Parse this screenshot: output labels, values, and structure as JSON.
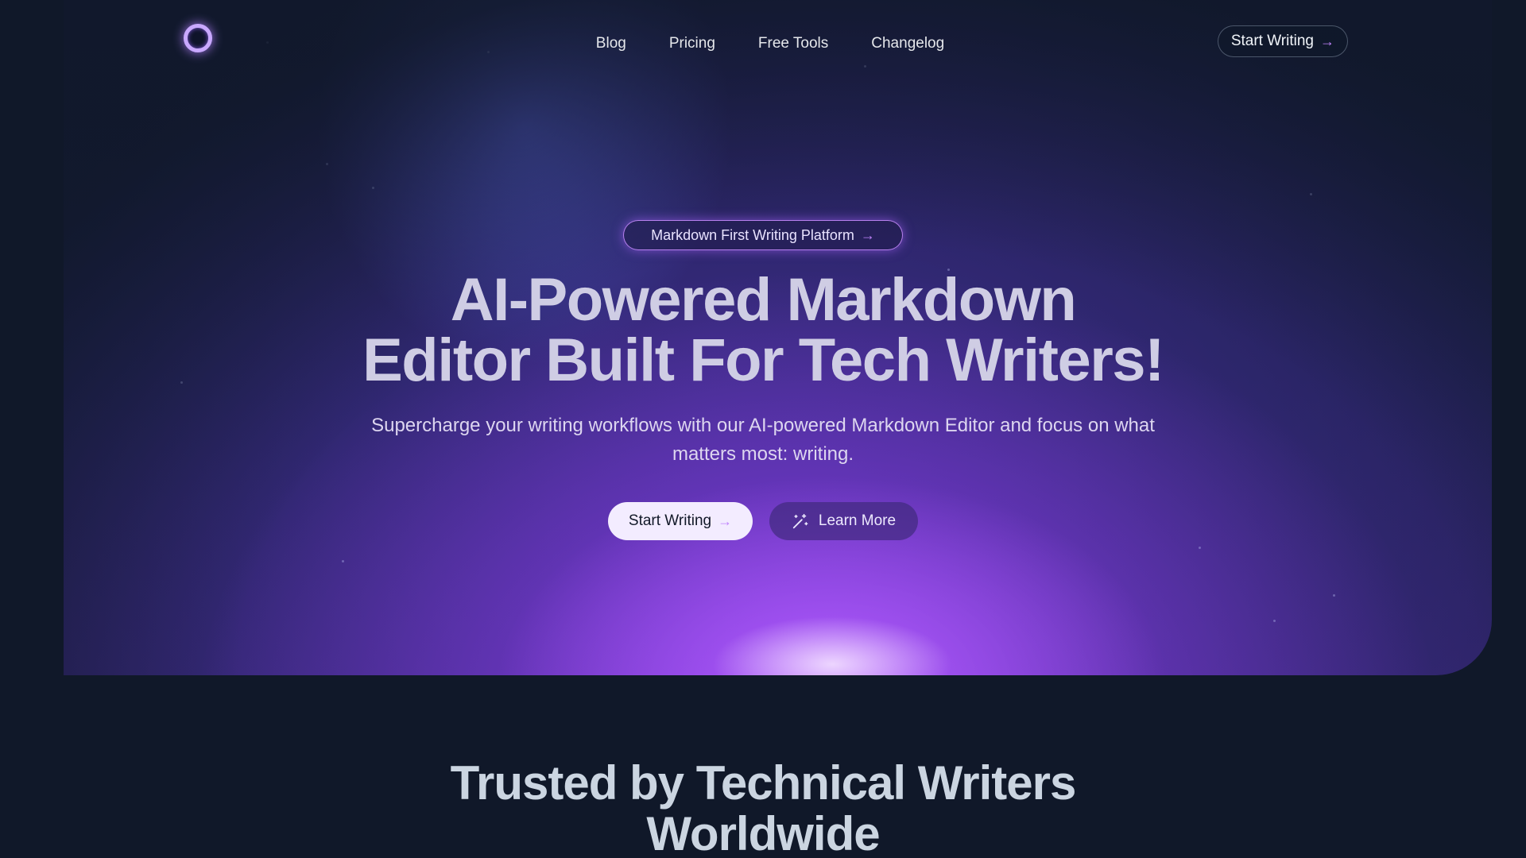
{
  "nav": {
    "links": [
      {
        "label": "Blog"
      },
      {
        "label": "Pricing"
      },
      {
        "label": "Free Tools"
      },
      {
        "label": "Changelog"
      }
    ],
    "cta_label": "Start Writing"
  },
  "hero": {
    "badge_label": "Markdown First Writing Platform",
    "headline_line1": "AI-Powered Markdown",
    "headline_line2": "Editor Built For Tech Writers!",
    "subtext": "Supercharge your writing workflows with our AI-powered Markdown Editor and focus on what matters most: writing.",
    "primary_label": "Start Writing",
    "secondary_label": "Learn More"
  },
  "trusted": {
    "line1": "Trusted by Technical Writers",
    "line2": "Worldwide"
  },
  "icons": {
    "arrow": "arrow-right-icon",
    "wand": "magic-wand-icon",
    "logo": "ring-logo"
  },
  "colors": {
    "background": "#101829",
    "accent": "#c084fc",
    "primary_button": "#f3ecff"
  }
}
